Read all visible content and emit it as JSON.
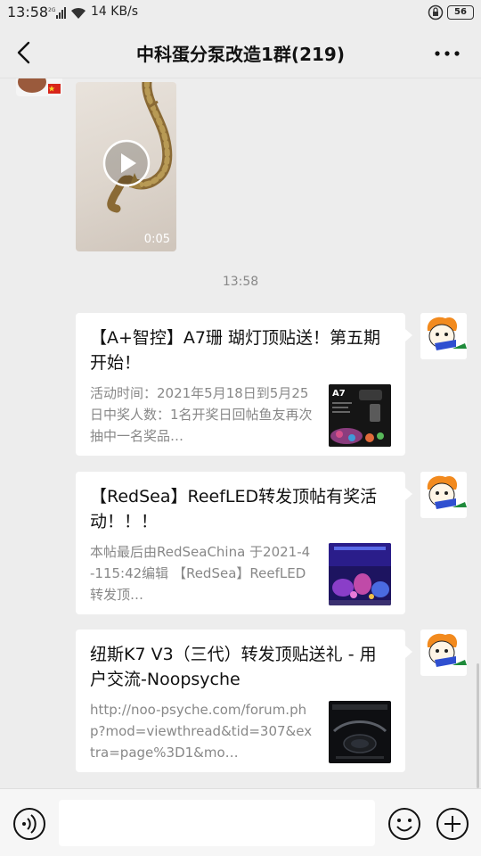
{
  "status_bar": {
    "time": "13:58",
    "speed": "14 KB/s",
    "battery": "56"
  },
  "header": {
    "title": "中科蛋分泵改造1群(219)",
    "back_icon": "back-arrow-icon",
    "more_icon": "more-dots-icon"
  },
  "chat": {
    "video": {
      "duration": "0:05"
    },
    "timestamp": "13:58",
    "messages": [
      {
        "title": "【A+智控】A7珊 瑚灯顶贴送！第五期开始！",
        "description": "活动时间：2021年5月18日到5月25日中奖人数：1名开奖日回帖鱼友再次抽中一名奖品…"
      },
      {
        "title": "【RedSea】ReefLED转发顶帖有奖活动！！！",
        "description": "本帖最后由RedSeaChina 于2021-4-115:42编辑 【RedSea】ReefLED转发顶…"
      },
      {
        "title": "纽斯K7 V3（三代）转发顶贴送礼 - 用户交流-Noopsyche",
        "description": "http://noo-psyche.com/forum.php?mod=viewthread&tid=307&extra=page%3D1&mo…"
      }
    ]
  },
  "input_bar": {
    "voice_icon": "voice-icon",
    "emoji_icon": "emoji-icon",
    "plus_icon": "plus-icon"
  },
  "colors": {
    "background": "#ededed",
    "card": "#ffffff",
    "secondary_text": "#888888"
  }
}
